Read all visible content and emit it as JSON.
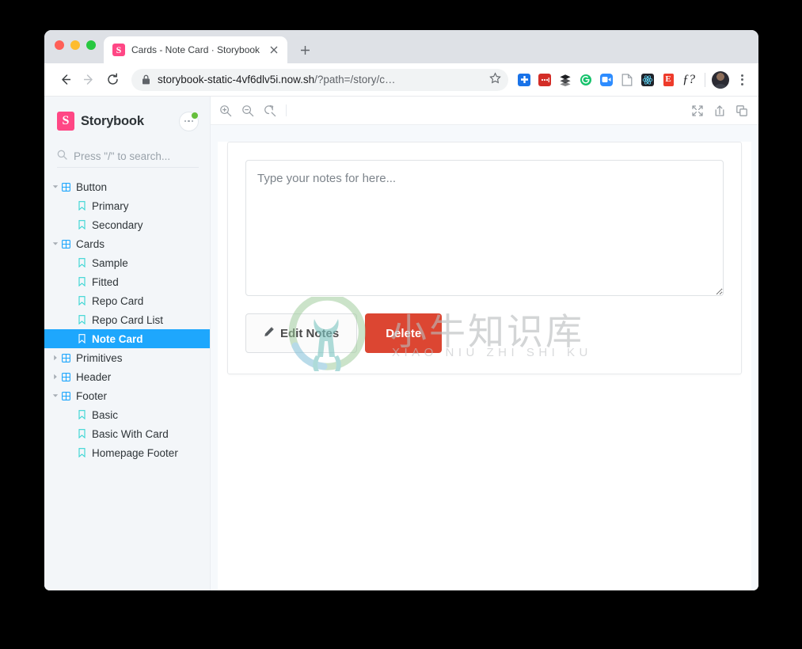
{
  "browser": {
    "tab": {
      "title": "Cards - Note Card · Storybook",
      "favicon_letter": "S",
      "favicon_color": "#ff4785",
      "close_icon": "close-icon"
    },
    "new_tab_label": "+",
    "nav": {
      "back_icon": "back-arrow-icon",
      "forward_icon": "forward-arrow-icon",
      "reload_icon": "reload-icon"
    },
    "omnibox": {
      "lock_icon": "lock-icon",
      "url_main": "storybook-static-4vf6dlv5i.now.sh",
      "url_path": "/?path=/story/c…",
      "star_icon": "bookmark-star-icon"
    },
    "extensions": [
      {
        "name": "plus-extension-icon",
        "glyph": "✚",
        "bg": "#1a73e8",
        "fg": "#ffffff"
      },
      {
        "name": "lastpass-extension-icon",
        "glyph": "•••",
        "bg": "#d32d27",
        "fg": "#ffffff"
      },
      {
        "name": "buffer-extension-icon",
        "glyph": "stack",
        "bg": "transparent",
        "fg": "#1d1f22"
      },
      {
        "name": "grammarly-extension-icon",
        "glyph": "G",
        "bg": "#15c26b",
        "fg": "#ffffff"
      },
      {
        "name": "zoom-extension-icon",
        "glyph": "video",
        "bg": "#2d8cff",
        "fg": "#ffffff"
      },
      {
        "name": "page-extension-icon",
        "glyph": "page",
        "bg": "transparent",
        "fg": "#9aa0a6"
      },
      {
        "name": "react-devtools-extension-icon",
        "glyph": "atom",
        "bg": "#20232a",
        "fg": "#61dafb"
      },
      {
        "name": "evernote-extension-icon",
        "glyph": "E",
        "bg": "#ee3b2b",
        "fg": "#ffffff"
      },
      {
        "name": "fontface-ninja-extension-icon",
        "glyph": "ƒ?",
        "bg": "transparent",
        "fg": "#1d1f22"
      }
    ],
    "avatar_name": "profile-avatar",
    "menu_icon": "browser-menu-icon"
  },
  "sidebar": {
    "brand": {
      "name": "Storybook",
      "logo_letter": "S",
      "logo_color": "#ff4785"
    },
    "menu_button": {
      "name": "sidebar-menu-button",
      "badge_color": "#66bf3c"
    },
    "search": {
      "placeholder": "Press \"/\" to search...",
      "icon": "search-icon"
    },
    "tree": [
      {
        "label": "Button",
        "type": "component",
        "depth": 0,
        "expanded": true,
        "selected": false
      },
      {
        "label": "Primary",
        "type": "story",
        "depth": 1,
        "selected": false
      },
      {
        "label": "Secondary",
        "type": "story",
        "depth": 1,
        "selected": false
      },
      {
        "label": "Cards",
        "type": "component",
        "depth": 0,
        "expanded": true,
        "selected": false
      },
      {
        "label": "Sample",
        "type": "story",
        "depth": 1,
        "selected": false
      },
      {
        "label": "Fitted",
        "type": "story",
        "depth": 1,
        "selected": false
      },
      {
        "label": "Repo Card",
        "type": "story",
        "depth": 1,
        "selected": false
      },
      {
        "label": "Repo Card List",
        "type": "story",
        "depth": 1,
        "selected": false
      },
      {
        "label": "Note Card",
        "type": "story",
        "depth": 1,
        "selected": true
      },
      {
        "label": "Primitives",
        "type": "component",
        "depth": 0,
        "expanded": false,
        "selected": false
      },
      {
        "label": "Header",
        "type": "component",
        "depth": 0,
        "expanded": false,
        "selected": false
      },
      {
        "label": "Footer",
        "type": "component",
        "depth": 0,
        "expanded": true,
        "selected": false
      },
      {
        "label": "Basic",
        "type": "story",
        "depth": 1,
        "selected": false
      },
      {
        "label": "Basic With Card",
        "type": "story",
        "depth": 1,
        "selected": false
      },
      {
        "label": "Homepage Footer",
        "type": "story",
        "depth": 1,
        "selected": false
      }
    ],
    "colors": {
      "selected_bg": "#1ea7fd",
      "component_icon": "#1ea7fd",
      "story_icon": "#37d5d3",
      "background": "#f3f6f9"
    }
  },
  "preview": {
    "toolbar_left": [
      {
        "name": "zoom-in-icon",
        "title": "Zoom in"
      },
      {
        "name": "zoom-out-icon",
        "title": "Zoom out"
      },
      {
        "name": "zoom-reset-icon",
        "title": "Reset zoom"
      }
    ],
    "toolbar_right": [
      {
        "name": "fullscreen-icon",
        "title": "Go full screen"
      },
      {
        "name": "open-in-new-icon",
        "title": "Open canvas in new tab"
      },
      {
        "name": "copy-canvas-icon",
        "title": "Copy canvas link"
      }
    ]
  },
  "story": {
    "notes_placeholder": "Type your notes for here...",
    "notes_value": "",
    "edit_button": {
      "label": "Edit Notes",
      "icon": "pencil-icon"
    },
    "delete_button": {
      "label": "Delete",
      "color": "#dc4632"
    }
  },
  "watermark": {
    "text_cn": "小牛知识库",
    "text_pinyin": "XIAO NIU ZHI SHI KU",
    "logo_name": "bull-logo-watermark"
  }
}
